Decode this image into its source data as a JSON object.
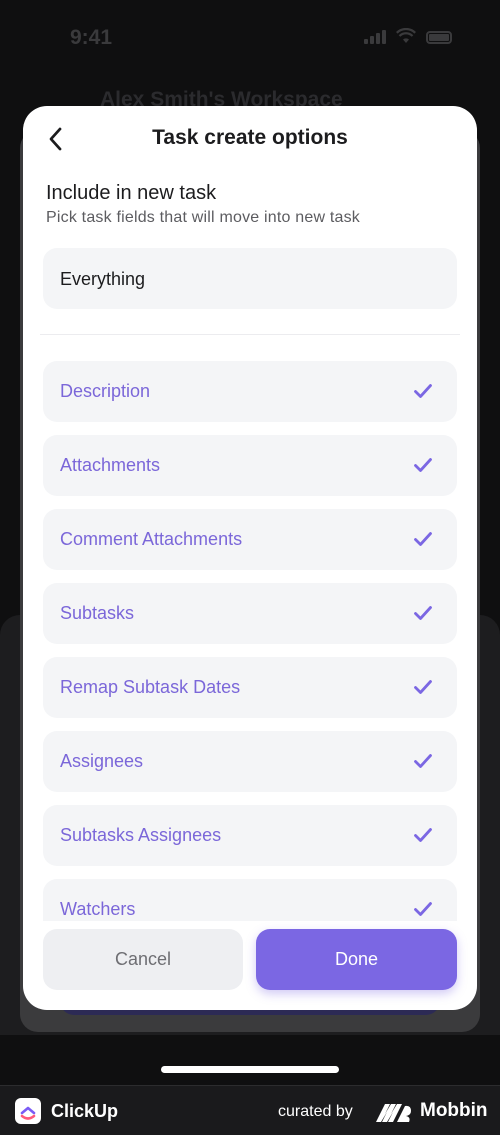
{
  "status_bar": {
    "time": "9:41"
  },
  "background": {
    "workspace_title": "Alex Smith's Workspace"
  },
  "modal": {
    "title": "Task create options",
    "section_title": "Include in new task",
    "section_subtitle": "Pick task fields that will move into new task",
    "everything_label": "Everything",
    "options": [
      {
        "label": "Description",
        "checked": true
      },
      {
        "label": "Attachments",
        "checked": true
      },
      {
        "label": "Comment Attachments",
        "checked": true
      },
      {
        "label": "Subtasks",
        "checked": true
      },
      {
        "label": "Remap Subtask Dates",
        "checked": true
      },
      {
        "label": "Assignees",
        "checked": true
      },
      {
        "label": "Subtasks Assignees",
        "checked": true
      },
      {
        "label": "Watchers",
        "checked": true
      }
    ],
    "cancel_label": "Cancel",
    "done_label": "Done"
  },
  "footer": {
    "app_name": "ClickUp",
    "curated_by": "curated by",
    "brand": "Mobbin"
  },
  "colors": {
    "accent": "#7b67e3",
    "option_text": "#7b67d9",
    "row_background": "#f4f5f7"
  }
}
